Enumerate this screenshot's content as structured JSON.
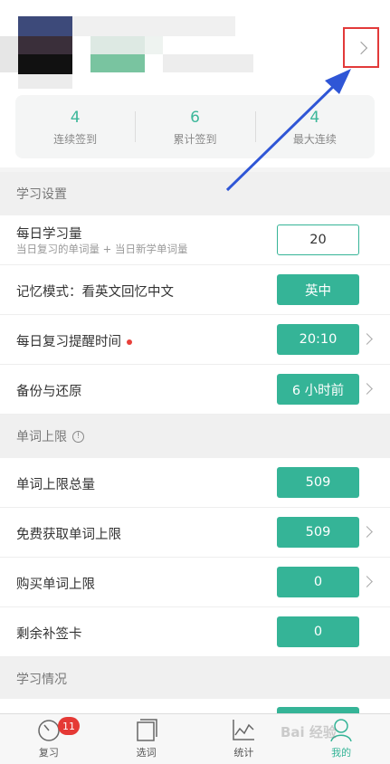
{
  "profile": {
    "stats": [
      {
        "value": "4",
        "label": "连续签到"
      },
      {
        "value": "6",
        "label": "累计签到"
      },
      {
        "value": "4",
        "label": "最大连续"
      }
    ]
  },
  "sections": {
    "study_settings": "学习设置",
    "word_limit": "单词上限",
    "study_status": "学习情况"
  },
  "settings": {
    "daily_amount_label": "每日学习量",
    "daily_amount_sub": "当日复习的单词量 + 当日新学单词量",
    "daily_amount_value": "20",
    "memory_mode_label": "记忆模式：看英文回忆中文",
    "memory_mode_value": "英中",
    "reminder_label": "每日复习提醒时间",
    "reminder_value": "20:10",
    "backup_label": "备份与还原",
    "backup_value": "6 小时前"
  },
  "limits": {
    "total_label": "单词上限总量",
    "total_value": "509",
    "free_label": "免费获取单词上限",
    "free_value": "509",
    "buy_label": "购买单词上限",
    "buy_value": "0",
    "cards_label": "剩余补签卡",
    "cards_value": "0"
  },
  "tabs": [
    {
      "label": "复习",
      "badge": "11"
    },
    {
      "label": "选词"
    },
    {
      "label": "统计"
    },
    {
      "label": "我的"
    }
  ],
  "watermark": "Bai 经验",
  "colors": {
    "accent": "#35b497",
    "badge": "#e53935",
    "annotation": "#2f56d6"
  }
}
